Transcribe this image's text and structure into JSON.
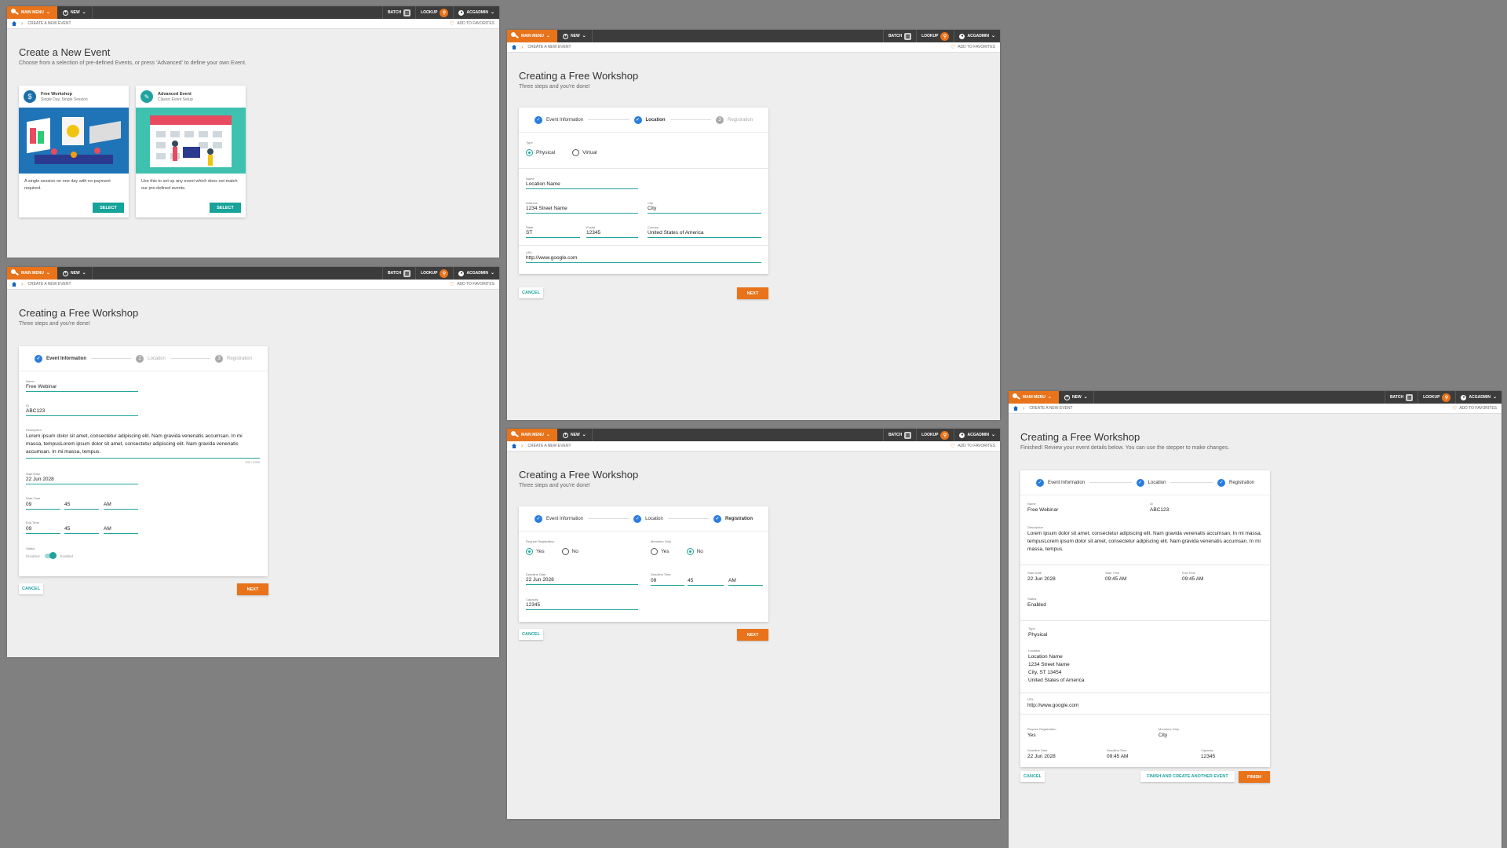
{
  "colors": {
    "accent": "#e8731a",
    "teal": "#20a39e",
    "step": "#2a7de1",
    "topbar": "#3c3c3c"
  },
  "nav": {
    "main_menu": "MAIN MENU",
    "new": "NEW",
    "batch": "BATCH",
    "lookup": "LOOKUP",
    "user": "ACGADMIN",
    "breadcrumb": "CREATE A NEW EVENT",
    "favorites": "ADD TO FAVORITES"
  },
  "create": {
    "title": "Create a New Event",
    "subtitle": "Choose from a selection of pre-defined Events, or press 'Advanced' to define your own Event.",
    "cards": [
      {
        "title": "Free Workshop",
        "subtitle": "Single Day, Single Session",
        "desc": "A single session on one day with no payment required.",
        "button": "SELECT",
        "icon": "dollar-icon"
      },
      {
        "title": "Advanced Event",
        "subtitle": "Classic Event Setup",
        "desc": "Use this to set up any event which does not match our pre-defined events.",
        "button": "SELECT",
        "icon": "wrench-icon"
      }
    ]
  },
  "wizard": {
    "title": "Creating a Free Workshop",
    "subtitle": "Three steps and you're done!",
    "finished_subtitle": "Finished! Review your event details below. You can use the stepper to make changes.",
    "steps": [
      "Event Information",
      "Location",
      "Registration"
    ],
    "step_numbers": [
      "2",
      "3"
    ],
    "cancel": "CANCEL",
    "next": "NEXT",
    "finish_another": "FINISH AND CREATE ANOTHER EVENT",
    "finish": "FINISH"
  },
  "event": {
    "name_label": "Name",
    "name": "Free Webinar",
    "id_label": "ID",
    "id": "ABC123",
    "desc_label": "Description",
    "desc": "Lorem ipsum dolor sit amet, consectetur adipiscing elit. Nam gravida venenatis accumsan. In mi massa, tempusLorem ipsum dolor sit amet, consectetur adipiscing elit. Nam gravida venenatis accumsan. In mi massa, tempus.",
    "counter": "235 / 4000",
    "start_date_label": "Start Date",
    "start_date": "22 Jun 2028",
    "start_time_label": "Start Time",
    "end_time_label": "End Time",
    "hour": "09",
    "minute": "45",
    "ampm": "AM",
    "time_full": "09:45 AM",
    "status_label": "Status",
    "disabled": "Disabled",
    "enabled": "Enabled",
    "status": "Enabled"
  },
  "location": {
    "type_label": "Type",
    "physical": "Physical",
    "virtual": "Virtual",
    "name_label": "Name",
    "name": "Location Name",
    "address_label": "Address",
    "address": "1234 Street Name",
    "city_label": "City",
    "city": "City",
    "state_label": "State",
    "state": "ST",
    "postal_label": "Postal",
    "postal": "12345",
    "country_label": "Country",
    "country": "United States of America",
    "url_label": "URL",
    "url": "http://www.google.com",
    "location_label": "Location",
    "city_line": "City, ST 13454"
  },
  "registration": {
    "require_label": "Require Registration",
    "members_label": "Members Only",
    "yes": "Yes",
    "no": "No",
    "deadline_date_label": "Deadline Date",
    "deadline_date": "22 Jun 2028",
    "deadline_time_label": "Deadline Time",
    "capacity_label": "Capacity",
    "capacity": "12345",
    "review_members": "City"
  }
}
